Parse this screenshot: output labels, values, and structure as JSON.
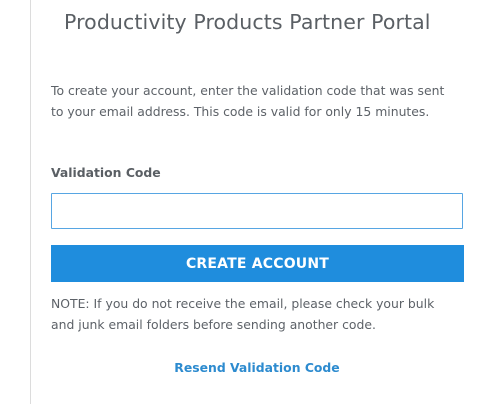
{
  "page": {
    "title": "Productivity Products Partner Portal"
  },
  "form": {
    "intro_text": "To create your account, enter the validation code that was sent to your email address. This code is valid for only 15 minutes.",
    "validation_code_label": "Validation Code",
    "validation_code_value": "",
    "validation_code_placeholder": "",
    "create_account_label": "CREATE ACCOUNT",
    "note_text": "NOTE: If you do not receive the email, please check your bulk and junk email folders before sending another code.",
    "resend_label": "Resend Validation Code"
  },
  "colors": {
    "primary_button": "#1f8ddd",
    "link": "#2d8bcf",
    "input_border": "#57a6e3",
    "text": "#5d6268"
  }
}
